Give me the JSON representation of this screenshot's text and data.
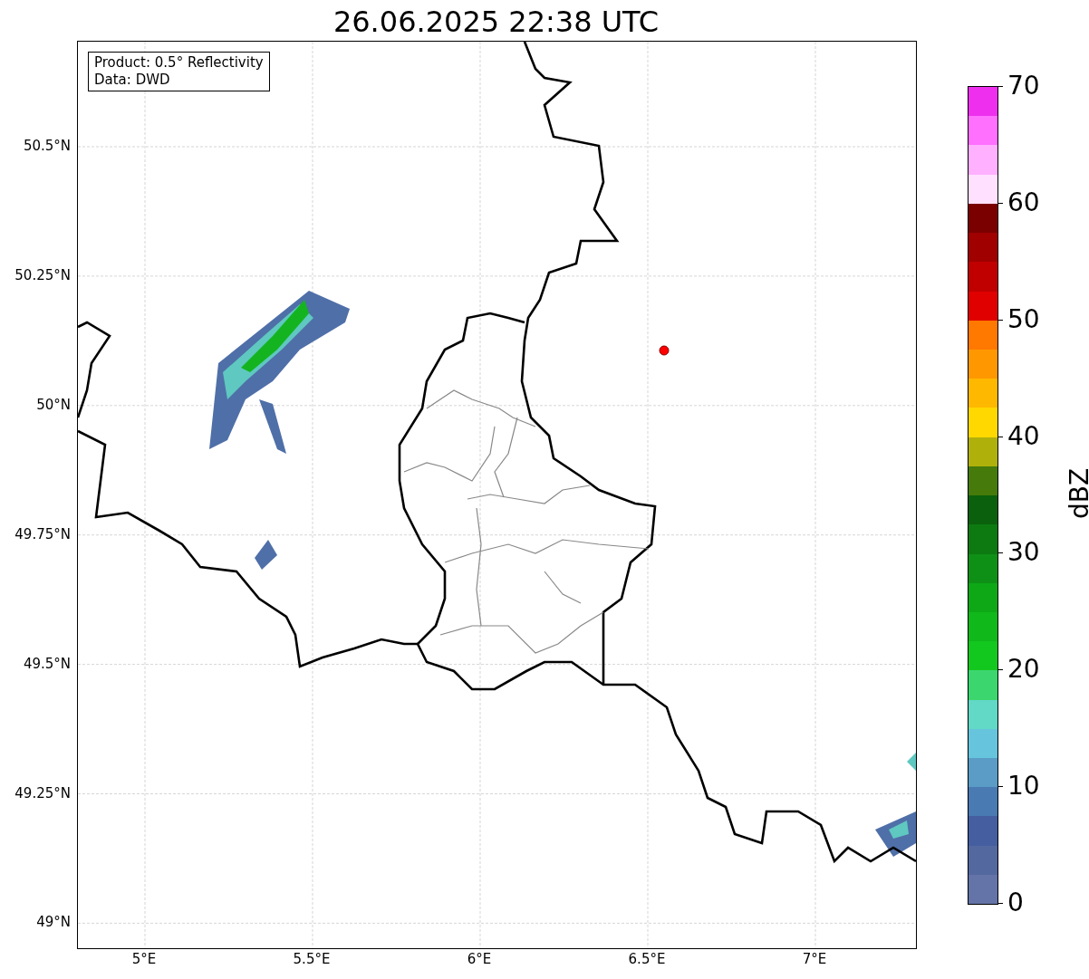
{
  "title": "26.06.2025 22:38 UTC",
  "info_box": [
    "Product: 0.5° Reflectivity",
    "Data: DWD"
  ],
  "map": {
    "lat_ticks": [
      "50.5°N",
      "50.25°N",
      "50°N",
      "49.75°N",
      "49.5°N",
      "49.25°N",
      "49°N"
    ],
    "lon_ticks": [
      "5°E",
      "5.5°E",
      "6°E",
      "6.5°E",
      "7°E"
    ]
  },
  "colorbar": {
    "label": "dBZ",
    "ticks": [
      "70",
      "60",
      "50",
      "40",
      "30",
      "20",
      "10",
      "0"
    ],
    "bins": [
      {
        "color": "#ee30ee"
      },
      {
        "color": "#ff70ff"
      },
      {
        "color": "#ffb0ff"
      },
      {
        "color": "#ffe0ff"
      },
      {
        "color": "#7a0000"
      },
      {
        "color": "#a00000"
      },
      {
        "color": "#c00000"
      },
      {
        "color": "#e00000"
      },
      {
        "color": "#ff7800"
      },
      {
        "color": "#ff9800"
      },
      {
        "color": "#ffb800"
      },
      {
        "color": "#ffd800"
      },
      {
        "color": "#b0b00a"
      },
      {
        "color": "#467a0a"
      },
      {
        "color": "#0a600c"
      },
      {
        "color": "#0c7a10"
      },
      {
        "color": "#0e9016"
      },
      {
        "color": "#0ea816"
      },
      {
        "color": "#10b81a"
      },
      {
        "color": "#12c81e"
      },
      {
        "color": "#3cd66e"
      },
      {
        "color": "#62d8c6"
      },
      {
        "color": "#66c4dc"
      },
      {
        "color": "#5a9cc6"
      },
      {
        "color": "#4a7ab2"
      },
      {
        "color": "#445ea0"
      },
      {
        "color": "#5468a0"
      },
      {
        "color": "#6474a8"
      }
    ]
  }
}
